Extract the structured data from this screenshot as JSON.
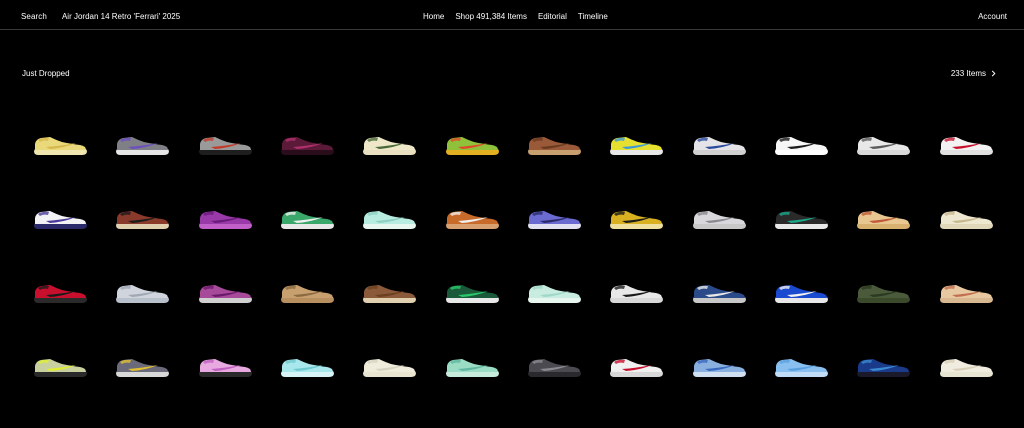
{
  "topbar": {
    "search_label": "Search",
    "search_value": "Air Jordan 14 Retro 'Ferrari' 2025",
    "nav": [
      {
        "label": "Home"
      },
      {
        "label": "Shop 491,384 Items"
      },
      {
        "label": "Editorial"
      },
      {
        "label": "Timeline"
      }
    ],
    "account_label": "Account"
  },
  "section": {
    "title": "Just Dropped",
    "count_label": "233 Items",
    "chevron_icon": "chevron-right-icon"
  },
  "products": [
    {
      "icon": "sneaker-icon",
      "upper": "#e9d97a",
      "accent": "#d6b84f",
      "sole": "#f0e6b0"
    },
    {
      "icon": "sneaker-icon",
      "upper": "#7f7f86",
      "accent": "#6b4fbf",
      "sole": "#e6e6e6"
    },
    {
      "icon": "sneaker-icon",
      "upper": "#9a9a9a",
      "accent": "#c23b2a",
      "sole": "#1e1e1e"
    },
    {
      "icon": "sneaker-icon",
      "upper": "#5a1a38",
      "accent": "#b0306e",
      "sole": "#2a0d1a"
    },
    {
      "icon": "sneaker-icon",
      "upper": "#eee8c8",
      "accent": "#4a6a3a",
      "sole": "#e8e0c0"
    },
    {
      "icon": "sneaker-icon",
      "upper": "#8fc23a",
      "accent": "#e04a2a",
      "sole": "#e2b020"
    },
    {
      "icon": "sneaker-icon",
      "upper": "#9a5a3a",
      "accent": "#6a3a20",
      "sole": "#c8a070"
    },
    {
      "icon": "sneaker-icon",
      "upper": "#e6e030",
      "accent": "#3a9ad8",
      "sole": "#e8e8e8"
    },
    {
      "icon": "sneaker-icon",
      "upper": "#e4e4e8",
      "accent": "#2a4a9a",
      "sole": "#d0d0d0"
    },
    {
      "icon": "sneaker-icon",
      "upper": "#f6f6f6",
      "accent": "#1a1a1a",
      "sole": "#ffffff"
    },
    {
      "icon": "sneaker-icon",
      "upper": "#e8e8e8",
      "accent": "#5a5a5a",
      "sole": "#d8d8d8"
    },
    {
      "icon": "sneaker-icon",
      "upper": "#f2f2f2",
      "accent": "#c8102e",
      "sole": "#e0e0e0"
    },
    {
      "icon": "sneaker-icon",
      "upper": "#f2f2f5",
      "accent": "#4a3a9a",
      "sole": "#2a2a6a"
    },
    {
      "icon": "sneaker-icon",
      "upper": "#8a3a2a",
      "accent": "#1a1a1a",
      "sole": "#e0d0b0"
    },
    {
      "icon": "sneaker-icon",
      "upper": "#9a3aa8",
      "accent": "#6a1a7a",
      "sole": "#c060c8"
    },
    {
      "icon": "sneaker-icon",
      "upper": "#3aa86a",
      "accent": "#f0f0f0",
      "sole": "#e8e8e8"
    },
    {
      "icon": "sneaker-icon",
      "upper": "#b8ece0",
      "accent": "#90d0c4",
      "sole": "#e8f6f0"
    },
    {
      "icon": "sneaker-icon",
      "upper": "#c86a2a",
      "accent": "#f0f0f0",
      "sole": "#d8a070"
    },
    {
      "icon": "sneaker-icon",
      "upper": "#6a6ad0",
      "accent": "#2a2a6a",
      "sole": "#e0e0f0"
    },
    {
      "icon": "sneaker-icon",
      "upper": "#d8b020",
      "accent": "#1a1a1a",
      "sole": "#f0e0a0"
    },
    {
      "icon": "sneaker-icon",
      "upper": "#d8d8dc",
      "accent": "#8a8a90",
      "sole": "#c8c8c8"
    },
    {
      "icon": "sneaker-icon",
      "upper": "#2a2a2a",
      "accent": "#1aa88a",
      "sole": "#e8e8e8"
    },
    {
      "icon": "sneaker-icon",
      "upper": "#e8c890",
      "accent": "#c05a3a",
      "sole": "#d8b070"
    },
    {
      "icon": "sneaker-icon",
      "upper": "#efe8d0",
      "accent": "#c8b890",
      "sole": "#e0d8b8"
    },
    {
      "icon": "sneaker-icon",
      "upper": "#c8102e",
      "accent": "#1a1a1a",
      "sole": "#2a2a2a"
    },
    {
      "icon": "sneaker-icon",
      "upper": "#d0d4dc",
      "accent": "#a0a8b4",
      "sole": "#b8c0cc"
    },
    {
      "icon": "sneaker-icon",
      "upper": "#a84a9a",
      "accent": "#6a1a6a",
      "sole": "#d0d0d0"
    },
    {
      "icon": "sneaker-icon",
      "upper": "#c8a070",
      "accent": "#8a6a40",
      "sole": "#b89060"
    },
    {
      "icon": "sneaker-icon",
      "upper": "#8a5a3a",
      "accent": "#6a4020",
      "sole": "#e0d0b0"
    },
    {
      "icon": "sneaker-icon",
      "upper": "#1a5a3a",
      "accent": "#2ac86a",
      "sole": "#e8e8e8"
    },
    {
      "icon": "sneaker-icon",
      "upper": "#c8ece0",
      "accent": "#a0d8c8",
      "sole": "#e8f6f0"
    },
    {
      "icon": "sneaker-icon",
      "upper": "#e8e8e8",
      "accent": "#1a1a1a",
      "sole": "#d8d8d8"
    },
    {
      "icon": "sneaker-icon",
      "upper": "#2a4a8a",
      "accent": "#e8e8e8",
      "sole": "#c8c8c8"
    },
    {
      "icon": "sneaker-icon",
      "upper": "#1a4ad0",
      "accent": "#f0f0f0",
      "sole": "#e8e8e8"
    },
    {
      "icon": "sneaker-icon",
      "upper": "#4a5a3a",
      "accent": "#2a3a20",
      "sole": "#3a4a2a"
    },
    {
      "icon": "sneaker-icon",
      "upper": "#e8c8a0",
      "accent": "#c07050",
      "sole": "#d8b890"
    },
    {
      "icon": "sneaker-icon",
      "upper": "#c8d0a0",
      "accent": "#e0f030",
      "sole": "#2a2a2a"
    },
    {
      "icon": "sneaker-icon",
      "upper": "#6a6a7a",
      "accent": "#e0c030",
      "sole": "#d8d8d8"
    },
    {
      "icon": "sneaker-icon",
      "upper": "#e8a8e0",
      "accent": "#c060c0",
      "sole": "#2a2a2a"
    },
    {
      "icon": "sneaker-icon",
      "upper": "#a8e8ec",
      "accent": "#70c8d0",
      "sole": "#d8f4f6"
    },
    {
      "icon": "sneaker-icon",
      "upper": "#efecdc",
      "accent": "#d8d4c0",
      "sole": "#e8e4d0"
    },
    {
      "icon": "sneaker-icon",
      "upper": "#9adcc4",
      "accent": "#60b8a0",
      "sole": "#c8ecdc"
    },
    {
      "icon": "sneaker-icon",
      "upper": "#4a4a50",
      "accent": "#8a8a90",
      "sole": "#2a2a2e"
    },
    {
      "icon": "sneaker-icon",
      "upper": "#f0f0f0",
      "accent": "#c8102e",
      "sole": "#d8d8d8"
    },
    {
      "icon": "sneaker-icon",
      "upper": "#8ab0e0",
      "accent": "#3a6ac0",
      "sole": "#d0e0f0"
    },
    {
      "icon": "sneaker-icon",
      "upper": "#8ac0f0",
      "accent": "#5aa0e0",
      "sole": "#c0dcf6"
    },
    {
      "icon": "sneaker-icon",
      "upper": "#1a3a8a",
      "accent": "#3a8ad0",
      "sole": "#1a1a2a"
    },
    {
      "icon": "sneaker-icon",
      "upper": "#f0ece0",
      "accent": "#d8d0b8",
      "sole": "#e8e4d4"
    }
  ]
}
